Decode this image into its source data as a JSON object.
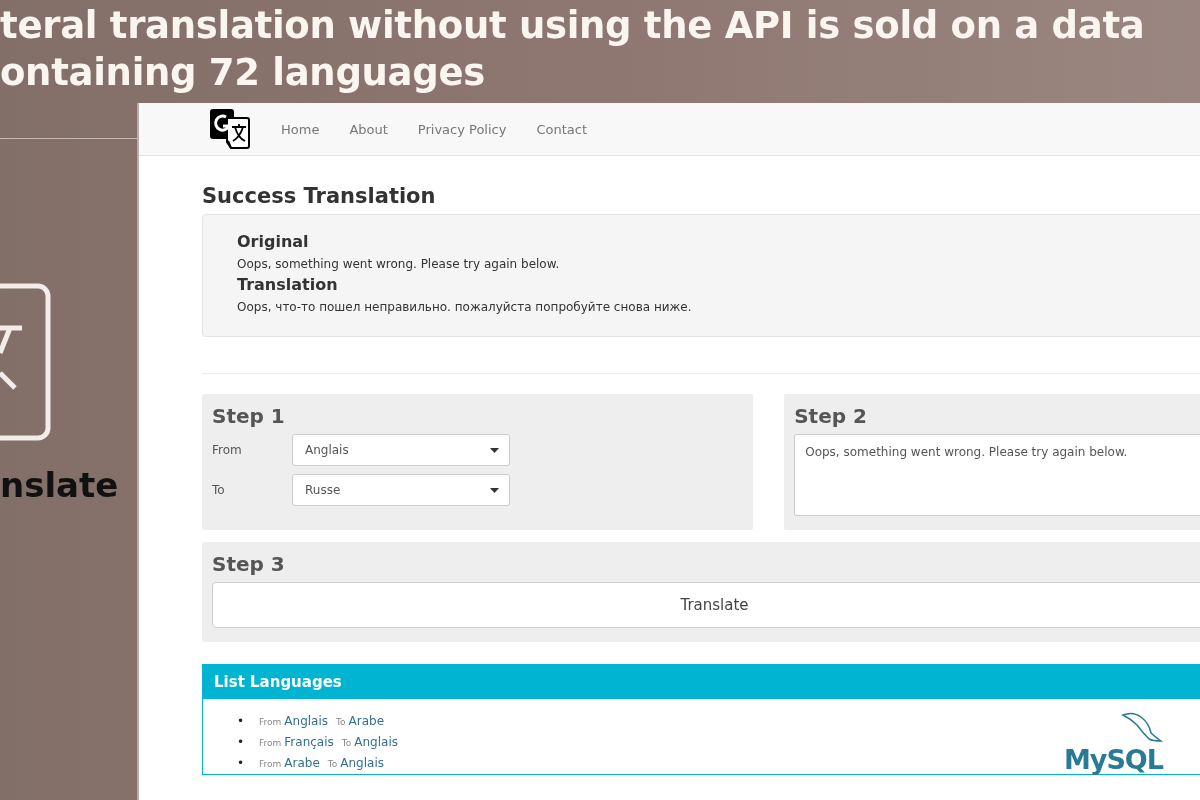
{
  "headline": {
    "lines": [
      "teral translation without using the API is sold on a data",
      "ontaining 72 languages"
    ]
  },
  "side_panel": {
    "label": "nslate"
  },
  "navbar": {
    "links": [
      {
        "label": "Home"
      },
      {
        "label": "About"
      },
      {
        "label": "Privacy Policy"
      },
      {
        "label": "Contact"
      }
    ]
  },
  "result": {
    "title": "Success Translation",
    "original_heading": "Original",
    "original_text": "Oops, something went wrong. Please try again below.",
    "translation_heading": "Translation",
    "translation_text": "Oops, что-то пошел неправильно. пожалуйста попробуйте снова ниже."
  },
  "step1": {
    "title": "Step 1",
    "fields": [
      {
        "label": "From",
        "value": "Anglais"
      },
      {
        "label": "To",
        "value": "Russe"
      }
    ]
  },
  "step2": {
    "title": "Step 2",
    "value": "Oops, something went wrong. Please try again below."
  },
  "step3": {
    "title": "Step 3",
    "button": "Translate"
  },
  "languages": {
    "title": "List Languages",
    "items": [
      {
        "bullet": "•",
        "from_label": "From",
        "from": "Anglais",
        "to_label": "To",
        "to": "Arabe"
      },
      {
        "bullet": "•",
        "from_label": "From",
        "from": "Français",
        "to_label": "To",
        "to": "Anglais"
      },
      {
        "bullet": "•",
        "from_label": "From",
        "from": "Arabe",
        "to_label": "To",
        "to": "Anglais"
      }
    ]
  },
  "logo": {
    "text": "MySQL"
  }
}
